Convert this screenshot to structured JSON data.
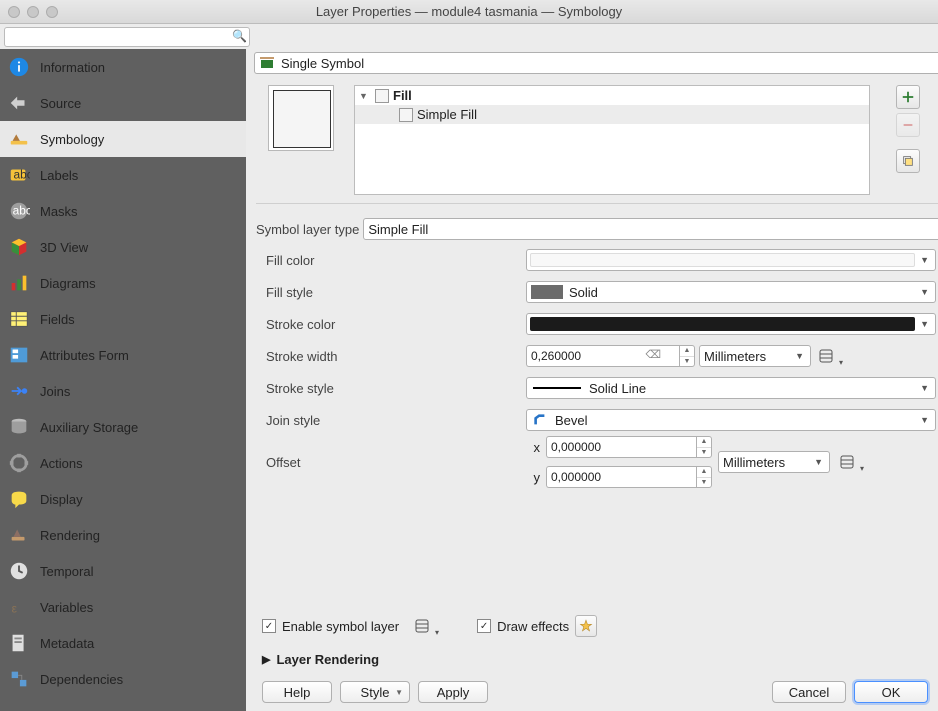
{
  "window": {
    "title": "Layer Properties — module4 tasmania — Symbology"
  },
  "search": {
    "placeholder": ""
  },
  "sidebar": {
    "items": [
      {
        "label": "Information"
      },
      {
        "label": "Source"
      },
      {
        "label": "Symbology"
      },
      {
        "label": "Labels"
      },
      {
        "label": "Masks"
      },
      {
        "label": "3D View"
      },
      {
        "label": "Diagrams"
      },
      {
        "label": "Fields"
      },
      {
        "label": "Attributes Form"
      },
      {
        "label": "Joins"
      },
      {
        "label": "Auxiliary Storage"
      },
      {
        "label": "Actions"
      },
      {
        "label": "Display"
      },
      {
        "label": "Rendering"
      },
      {
        "label": "Temporal"
      },
      {
        "label": "Variables"
      },
      {
        "label": "Metadata"
      },
      {
        "label": "Dependencies"
      }
    ]
  },
  "symbolizer": {
    "mode": "Single Symbol"
  },
  "tree": {
    "root": "Fill",
    "child": "Simple Fill"
  },
  "layer_type": {
    "label": "Symbol layer type",
    "value": "Simple Fill"
  },
  "props": {
    "fill_color": {
      "label": "Fill color",
      "hex": "#f8f8f8"
    },
    "fill_style": {
      "label": "Fill style",
      "value": "Solid",
      "swatch": "#6b6b6b"
    },
    "stroke_color": {
      "label": "Stroke color",
      "hex": "#1b1b1b"
    },
    "stroke_width": {
      "label": "Stroke width",
      "value": "0,260000",
      "unit": "Millimeters"
    },
    "stroke_style": {
      "label": "Stroke style",
      "value": "Solid Line"
    },
    "join_style": {
      "label": "Join style",
      "value": "Bevel"
    },
    "offset": {
      "label": "Offset",
      "x_label": "x",
      "y_label": "y",
      "x": "0,000000",
      "y": "0,000000",
      "unit": "Millimeters"
    }
  },
  "options": {
    "enable_layer": "Enable symbol layer",
    "draw_effects": "Draw effects"
  },
  "section": {
    "layer_rendering": "Layer Rendering"
  },
  "buttons": {
    "help": "Help",
    "style": "Style",
    "apply": "Apply",
    "cancel": "Cancel",
    "ok": "OK"
  }
}
